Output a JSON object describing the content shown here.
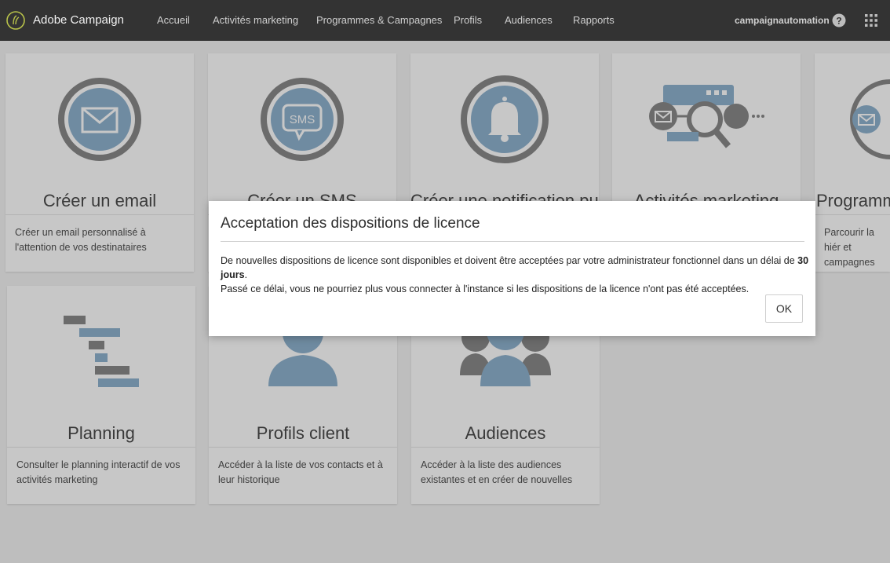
{
  "header": {
    "app_title": "Adobe Campaign",
    "nav": [
      "Accueil",
      "Activités marketing",
      "Programmes & Campagnes",
      "Profils",
      "Audiences",
      "Rapports"
    ],
    "user": "campaignautomation"
  },
  "cards": [
    {
      "title": "Créer un email",
      "desc": "Créer un email personnalisé à l'attention de vos destinataires"
    },
    {
      "title": "Créer un SMS",
      "desc": ""
    },
    {
      "title": "Créer une notification push",
      "desc": ""
    },
    {
      "title": "Activités marketing",
      "desc": ""
    },
    {
      "title": "Programmes",
      "desc": "Parcourir la hiér et campagnes"
    },
    {
      "title": "Planning",
      "desc": "Consulter le planning interactif de vos activités marketing"
    },
    {
      "title": "Profils client",
      "desc": "Accéder à la liste de vos contacts et à leur historique"
    },
    {
      "title": "Audiences",
      "desc": "Accéder à la liste des audiences existantes et en créer de nouvelles"
    }
  ],
  "illustrations": {
    "sms_label": "SMS"
  },
  "modal": {
    "title": "Acceptation des dispositions de licence",
    "body_line1_pre": "De nouvelles dispositions de licence sont disponibles et doivent être acceptées par votre administrateur fonctionnel dans un délai de ",
    "body_line1_bold": "30 jours",
    "body_line1_post": ".",
    "body_line2": "Passé ce délai, vous ne pourriez plus vous connecter à l'instance si les dispositions de la licence n'ont pas été acceptées.",
    "ok_label": "OK"
  },
  "colors": {
    "topbar": "#333333",
    "icon_blue": "#8fb2cf",
    "icon_grey": "#8a8a8a",
    "background": "#f4f4f4"
  }
}
